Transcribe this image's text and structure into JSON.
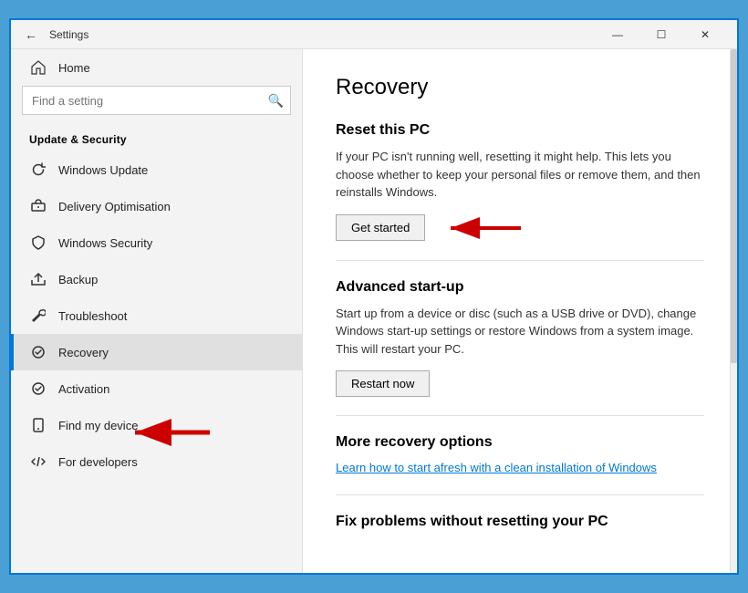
{
  "titlebar": {
    "title": "Settings",
    "min_label": "—",
    "max_label": "☐",
    "close_label": "✕"
  },
  "sidebar": {
    "search_placeholder": "Find a setting",
    "section_label": "Update & Security",
    "items": [
      {
        "id": "home",
        "label": "Home",
        "icon": "home"
      },
      {
        "id": "windows-update",
        "label": "Windows Update",
        "icon": "refresh"
      },
      {
        "id": "delivery-optimisation",
        "label": "Delivery Optimisation",
        "icon": "delivery"
      },
      {
        "id": "windows-security",
        "label": "Windows Security",
        "icon": "shield"
      },
      {
        "id": "backup",
        "label": "Backup",
        "icon": "backup"
      },
      {
        "id": "troubleshoot",
        "label": "Troubleshoot",
        "icon": "wrench"
      },
      {
        "id": "recovery",
        "label": "Recovery",
        "icon": "recovery",
        "active": true
      },
      {
        "id": "activation",
        "label": "Activation",
        "icon": "activation"
      },
      {
        "id": "find-my-device",
        "label": "Find my device",
        "icon": "find"
      },
      {
        "id": "for-developers",
        "label": "For developers",
        "icon": "developers"
      }
    ]
  },
  "main": {
    "page_title": "Recovery",
    "reset_section": {
      "title": "Reset this PC",
      "description": "If your PC isn't running well, resetting it might help. This lets you choose whether to keep your personal files or remove them, and then reinstalls Windows.",
      "button_label": "Get started"
    },
    "advanced_section": {
      "title": "Advanced start-up",
      "description": "Start up from a device or disc (such as a USB drive or DVD), change Windows start-up settings or restore Windows from a system image. This will restart your PC.",
      "button_label": "Restart now"
    },
    "more_options_section": {
      "title": "More recovery options",
      "link_text": "Learn how to start afresh with a clean installation of Windows"
    },
    "fix_section": {
      "title": "Fix problems without resetting your PC"
    }
  }
}
